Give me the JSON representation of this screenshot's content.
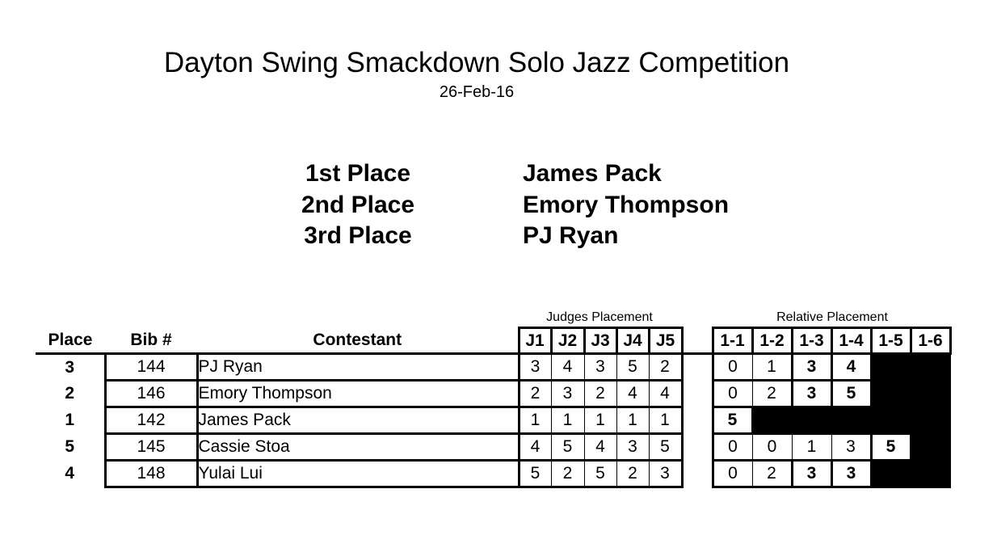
{
  "title": "Dayton Swing Smackdown Solo Jazz Competition",
  "date": "26-Feb-16",
  "winners": [
    {
      "label": "1st Place",
      "name": "James Pack"
    },
    {
      "label": "2nd Place",
      "name": "Emory Thompson"
    },
    {
      "label": "3rd Place",
      "name": "PJ Ryan"
    }
  ],
  "group_headers": {
    "judges": "Judges Placement",
    "relative": "Relative Placement"
  },
  "columns": {
    "place": "Place",
    "bib": "Bib #",
    "contestant": "Contestant",
    "judges": [
      "J1",
      "J2",
      "J3",
      "J4",
      "J5"
    ],
    "relative": [
      "1-1",
      "1-2",
      "1-3",
      "1-4",
      "1-5",
      "1-6"
    ]
  },
  "rows": [
    {
      "place": "3",
      "bib": "144",
      "name": "PJ Ryan",
      "judges": [
        "3",
        "4",
        "3",
        "5",
        "2"
      ],
      "relative": [
        "0",
        "1",
        "3",
        "4",
        "",
        ""
      ],
      "bold": [
        2,
        3
      ],
      "final": 3
    },
    {
      "place": "2",
      "bib": "146",
      "name": "Emory Thompson",
      "judges": [
        "2",
        "3",
        "2",
        "4",
        "4"
      ],
      "relative": [
        "0",
        "2",
        "3",
        "5",
        "",
        ""
      ],
      "bold": [
        2,
        3
      ],
      "final": 3
    },
    {
      "place": "1",
      "bib": "142",
      "name": "James Pack",
      "judges": [
        "1",
        "1",
        "1",
        "1",
        "1"
      ],
      "relative": [
        "5",
        "",
        "",
        "",
        "",
        ""
      ],
      "bold": [
        0
      ],
      "final": 0
    },
    {
      "place": "5",
      "bib": "145",
      "name": "Cassie Stoa",
      "judges": [
        "4",
        "5",
        "4",
        "3",
        "5"
      ],
      "relative": [
        "0",
        "0",
        "1",
        "3",
        "5",
        ""
      ],
      "bold": [
        4
      ],
      "final": 4
    },
    {
      "place": "4",
      "bib": "148",
      "name": "Yulai Lui",
      "judges": [
        "5",
        "2",
        "5",
        "2",
        "3"
      ],
      "relative": [
        "0",
        "2",
        "3",
        "3",
        "",
        ""
      ],
      "bold": [
        2,
        3
      ],
      "final": 3
    }
  ]
}
